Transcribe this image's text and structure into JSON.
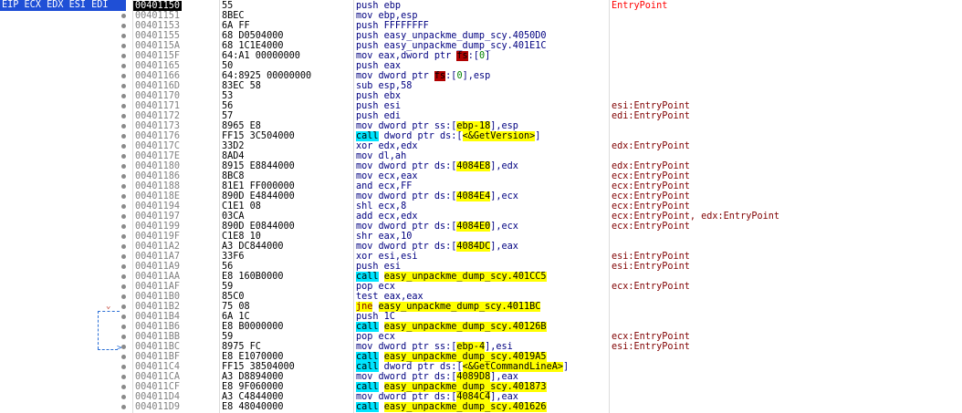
{
  "register_label": "EIP ECX EDX ESI EDI",
  "rows": [
    {
      "addr": "00401150",
      "bytes": "55",
      "ins": "push ebp",
      "cmt": "EntryPoint",
      "cur": true
    },
    {
      "addr": "00401151",
      "bytes": "8BEC",
      "ins": "mov ebp,esp",
      "cmt": ""
    },
    {
      "addr": "00401153",
      "bytes": "6A FF",
      "ins": "push FFFFFFFF",
      "cmt": ""
    },
    {
      "addr": "00401155",
      "bytes": "68 D0504000",
      "ins": "push easy_unpackme_dump_scy.4050D0",
      "cmt": ""
    },
    {
      "addr": "0040115A",
      "bytes": "68 1C1E4000",
      "ins": "push easy_unpackme_dump_scy.401E1C",
      "cmt": ""
    },
    {
      "addr": "0040115F",
      "bytes": "64:A1 00000000",
      "ins": "mov eax,dword ptr fs:[0]",
      "cmt": ""
    },
    {
      "addr": "00401165",
      "bytes": "50",
      "ins": "push eax",
      "cmt": ""
    },
    {
      "addr": "00401166",
      "bytes": "64:8925 00000000",
      "ins": "mov dword ptr fs:[0],esp",
      "cmt": ""
    },
    {
      "addr": "0040116D",
      "bytes": "83EC 58",
      "ins": "sub esp,58",
      "cmt": ""
    },
    {
      "addr": "00401170",
      "bytes": "53",
      "ins": "push ebx",
      "cmt": ""
    },
    {
      "addr": "00401171",
      "bytes": "56",
      "ins": "push esi",
      "cmt": "esi:EntryPoint"
    },
    {
      "addr": "00401172",
      "bytes": "57",
      "ins": "push edi",
      "cmt": "edi:EntryPoint"
    },
    {
      "addr": "00401173",
      "bytes": "8965 E8",
      "ins": "mov dword ptr ss:[ebp-18],esp",
      "cmt": ""
    },
    {
      "addr": "00401176",
      "bytes": "FF15 3C504000",
      "ins": "call dword ptr ds:[<&GetVersion>]",
      "cmt": ""
    },
    {
      "addr": "0040117C",
      "bytes": "33D2",
      "ins": "xor edx,edx",
      "cmt": "edx:EntryPoint"
    },
    {
      "addr": "0040117E",
      "bytes": "8AD4",
      "ins": "mov dl,ah",
      "cmt": ""
    },
    {
      "addr": "00401180",
      "bytes": "8915 E8844000",
      "ins": "mov dword ptr ds:[4084E8],edx",
      "cmt": "edx:EntryPoint"
    },
    {
      "addr": "00401186",
      "bytes": "8BC8",
      "ins": "mov ecx,eax",
      "cmt": "ecx:EntryPoint"
    },
    {
      "addr": "00401188",
      "bytes": "81E1 FF000000",
      "ins": "and ecx,FF",
      "cmt": "ecx:EntryPoint"
    },
    {
      "addr": "0040118E",
      "bytes": "890D E4844000",
      "ins": "mov dword ptr ds:[4084E4],ecx",
      "cmt": "ecx:EntryPoint"
    },
    {
      "addr": "00401194",
      "bytes": "C1E1 08",
      "ins": "shl ecx,8",
      "cmt": "ecx:EntryPoint"
    },
    {
      "addr": "00401197",
      "bytes": "03CA",
      "ins": "add ecx,edx",
      "cmt": "ecx:EntryPoint, edx:EntryPoint"
    },
    {
      "addr": "00401199",
      "bytes": "890D E0844000",
      "ins": "mov dword ptr ds:[4084E0],ecx",
      "cmt": "ecx:EntryPoint"
    },
    {
      "addr": "0040119F",
      "bytes": "C1E8 10",
      "ins": "shr eax,10",
      "cmt": ""
    },
    {
      "addr": "004011A2",
      "bytes": "A3 DC844000",
      "ins": "mov dword ptr ds:[4084DC],eax",
      "cmt": ""
    },
    {
      "addr": "004011A7",
      "bytes": "33F6",
      "ins": "xor esi,esi",
      "cmt": "esi:EntryPoint"
    },
    {
      "addr": "004011A9",
      "bytes": "56",
      "ins": "push esi",
      "cmt": "esi:EntryPoint"
    },
    {
      "addr": "004011AA",
      "bytes": "E8 160B0000",
      "ins": "call easy_unpackme_dump_scy.401CC5",
      "cmt": ""
    },
    {
      "addr": "004011AF",
      "bytes": "59",
      "ins": "pop ecx",
      "cmt": "ecx:EntryPoint"
    },
    {
      "addr": "004011B0",
      "bytes": "85C0",
      "ins": "test eax,eax",
      "cmt": ""
    },
    {
      "addr": "004011B2",
      "bytes": "75 08",
      "ins": "jne easy_unpackme_dump_scy.4011BC",
      "cmt": "",
      "arrow": "v"
    },
    {
      "addr": "004011B4",
      "bytes": "6A 1C",
      "ins": "push 1C",
      "cmt": ""
    },
    {
      "addr": "004011B6",
      "bytes": "E8 B0000000",
      "ins": "call easy_unpackme_dump_scy.40126B",
      "cmt": ""
    },
    {
      "addr": "004011BB",
      "bytes": "59",
      "ins": "pop ecx",
      "cmt": "ecx:EntryPoint"
    },
    {
      "addr": "004011BC",
      "bytes": "8975 FC",
      "ins": "mov dword ptr ss:[ebp-4],esi",
      "cmt": "esi:EntryPoint"
    },
    {
      "addr": "004011BF",
      "bytes": "E8 E1070000",
      "ins": "call easy_unpackme_dump_scy.4019A5",
      "cmt": ""
    },
    {
      "addr": "004011C4",
      "bytes": "FF15 38504000",
      "ins": "call dword ptr ds:[<&GetCommandLineA>]",
      "cmt": ""
    },
    {
      "addr": "004011CA",
      "bytes": "A3 D8894000",
      "ins": "mov dword ptr ds:[4089D8],eax",
      "cmt": ""
    },
    {
      "addr": "004011CF",
      "bytes": "E8 9F060000",
      "ins": "call easy_unpackme_dump_scy.401873",
      "cmt": ""
    },
    {
      "addr": "004011D4",
      "bytes": "A3 C4844000",
      "ins": "mov dword ptr ds:[4084C4],eax",
      "cmt": ""
    },
    {
      "addr": "004011D9",
      "bytes": "E8 48040000",
      "ins": "call easy_unpackme_dump_scy.401626",
      "cmt": ""
    }
  ]
}
